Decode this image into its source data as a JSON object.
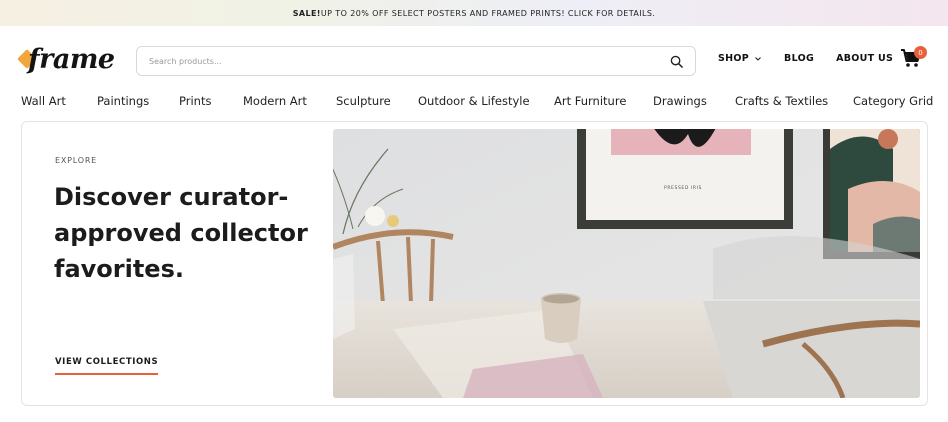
{
  "promo": {
    "bold": "SALE!",
    "text": " UP TO 20% OFF SELECT POSTERS AND FRAMED PRINTS! CLICK FOR DETAILS."
  },
  "logo": {
    "text": "frame"
  },
  "search": {
    "placeholder": "Search products..."
  },
  "top_nav": {
    "shop": "SHOP",
    "blog": "BLOG",
    "about": "ABOUT US"
  },
  "cart": {
    "count": "0"
  },
  "categories": [
    "Wall Art",
    "Paintings",
    "Prints",
    "Modern Art",
    "Sculpture",
    "Outdoor & Lifestyle",
    "Art Furniture",
    "Drawings",
    "Crafts & Textiles",
    "Category Grid"
  ],
  "hero": {
    "eyebrow": "EXPLORE",
    "headline": "Discover curator-approved collector favorites.",
    "cta": "VIEW COLLECTIONS",
    "poster_caption": "PRESSED IRIS"
  },
  "colors": {
    "accent": "#e8603b",
    "logo_mark": "#f0a63a"
  }
}
